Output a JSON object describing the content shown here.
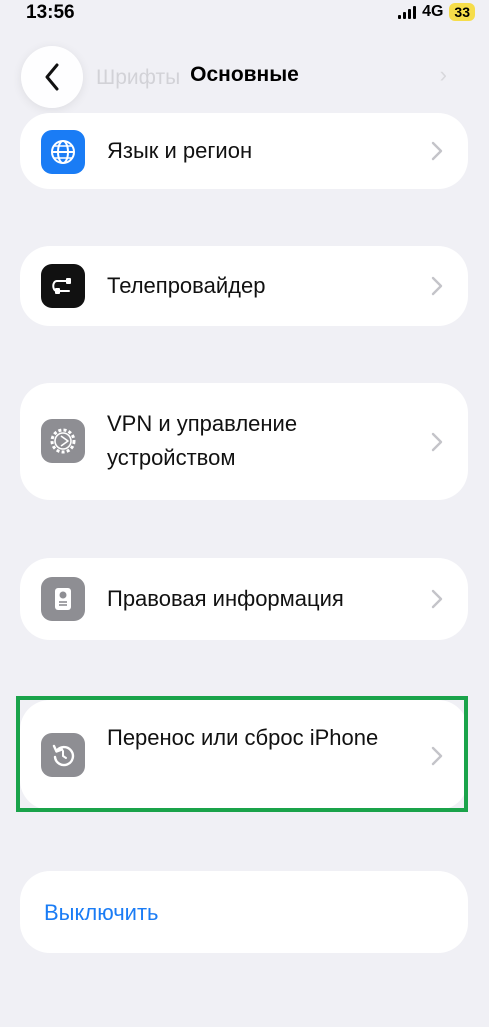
{
  "status_bar": {
    "time": "13:56",
    "network": "4G",
    "battery": "33"
  },
  "header": {
    "title": "Основные",
    "faded_prev_item": "Шрифты"
  },
  "items": [
    {
      "label": "Язык и регион",
      "icon": "globe-icon",
      "icon_color": "#1a7cf5"
    },
    {
      "label": "Телепровайдер",
      "icon": "tv-provider-icon",
      "icon_color": "#111111"
    },
    {
      "label": "VPN и управление устройством",
      "icon": "gear-icon",
      "icon_color": "#8e8e93"
    },
    {
      "label": "Правовая информация",
      "icon": "certificate-icon",
      "icon_color": "#8e8e93"
    },
    {
      "label": "Перенос или сброс iPhone",
      "icon": "reset-icon",
      "icon_color": "#8e8e93"
    }
  ],
  "shutdown": {
    "label": "Выключить",
    "color": "#1a7cf5"
  },
  "highlight_color": "#1aa34a"
}
